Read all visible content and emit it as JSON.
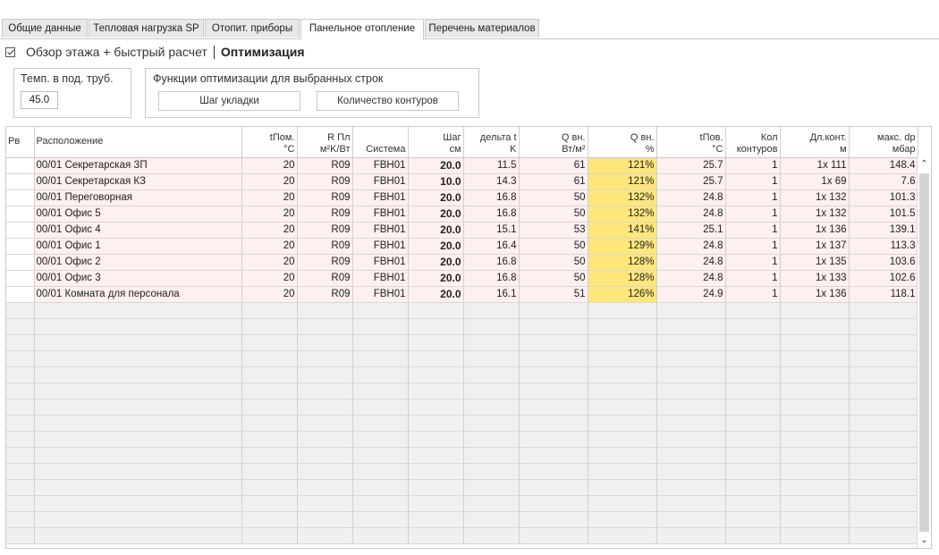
{
  "tabs": [
    "Общие данные",
    "Тепловая нагрузка SP",
    "Отопит. приборы",
    "Панельное отопление",
    "Перечень материалов"
  ],
  "active_tab": 3,
  "subbar": {
    "overview_label": "Обзор этажа + быстрый расчет",
    "optimization_label": "Оптимизация",
    "checked": true
  },
  "temp_box": {
    "title": "Темп. в под. труб.",
    "value": "45.0"
  },
  "functions_box": {
    "title": "Функции оптимизации для выбранных строк",
    "btn_step": "Шаг укладки",
    "btn_circuits": "Количество контуров"
  },
  "columns": [
    [
      "Рв"
    ],
    [
      "Расположение"
    ],
    [
      "tПом.",
      "°C"
    ],
    [
      "R Пл",
      "м²K/Вт"
    ],
    [
      "Система"
    ],
    [
      "Шаг",
      "см"
    ],
    [
      "дельта t",
      "K"
    ],
    [
      "Q вн.",
      "Вт/м²"
    ],
    [
      "Q вн.",
      "%"
    ],
    [
      "tПов.",
      "°C"
    ],
    [
      "Кол",
      "контуров"
    ],
    [
      "Дл.конт.",
      "м"
    ],
    [
      "макс. dp",
      "мбар"
    ]
  ],
  "rows": [
    [
      "",
      "00/01 Секретарская ЗП",
      "20",
      "R09",
      "FBH01",
      "20.0",
      "11.5",
      "61",
      "121%",
      "25.7",
      "1",
      "1x 111",
      "148.4"
    ],
    [
      "",
      "00/01 Секретарская КЗ",
      "20",
      "R09",
      "FBH01",
      "10.0",
      "14.3",
      "61",
      "121%",
      "25.7",
      "1",
      "1x 69",
      "7.6"
    ],
    [
      "",
      "00/01 Переговорная",
      "20",
      "R09",
      "FBH01",
      "20.0",
      "16.8",
      "50",
      "132%",
      "24.8",
      "1",
      "1x 132",
      "101.3"
    ],
    [
      "",
      "00/01 Офис 5",
      "20",
      "R09",
      "FBH01",
      "20.0",
      "16.8",
      "50",
      "132%",
      "24.8",
      "1",
      "1x 132",
      "101.5"
    ],
    [
      "",
      "00/01 Офис 4",
      "20",
      "R09",
      "FBH01",
      "20.0",
      "15.1",
      "53",
      "141%",
      "25.1",
      "1",
      "1x 136",
      "139.1"
    ],
    [
      "",
      "00/01 Офис 1",
      "20",
      "R09",
      "FBH01",
      "20.0",
      "16.4",
      "50",
      "129%",
      "24.8",
      "1",
      "1x 137",
      "113.3"
    ],
    [
      "",
      "00/01 Офис 2",
      "20",
      "R09",
      "FBH01",
      "20.0",
      "16.8",
      "50",
      "128%",
      "24.8",
      "1",
      "1x 135",
      "103.6"
    ],
    [
      "",
      "00/01 Офис 3",
      "20",
      "R09",
      "FBH01",
      "20.0",
      "16.8",
      "50",
      "128%",
      "24.8",
      "1",
      "1x 133",
      "102.6"
    ],
    [
      "",
      "00/01 Комната для персонала",
      "20",
      "R09",
      "FBH01",
      "20.0",
      "16.1",
      "51",
      "126%",
      "24.9",
      "1",
      "1x 136",
      "118.1"
    ]
  ],
  "colors": {
    "row_pink": "#fdf0ee",
    "highlight_yellow": "#fde67c",
    "empty_row": "#f0f0f0"
  },
  "icons": {
    "checkbox": "checkbox-checked-icon",
    "scroll_up": "chevron-up-icon",
    "scroll_down": "chevron-down-icon"
  }
}
